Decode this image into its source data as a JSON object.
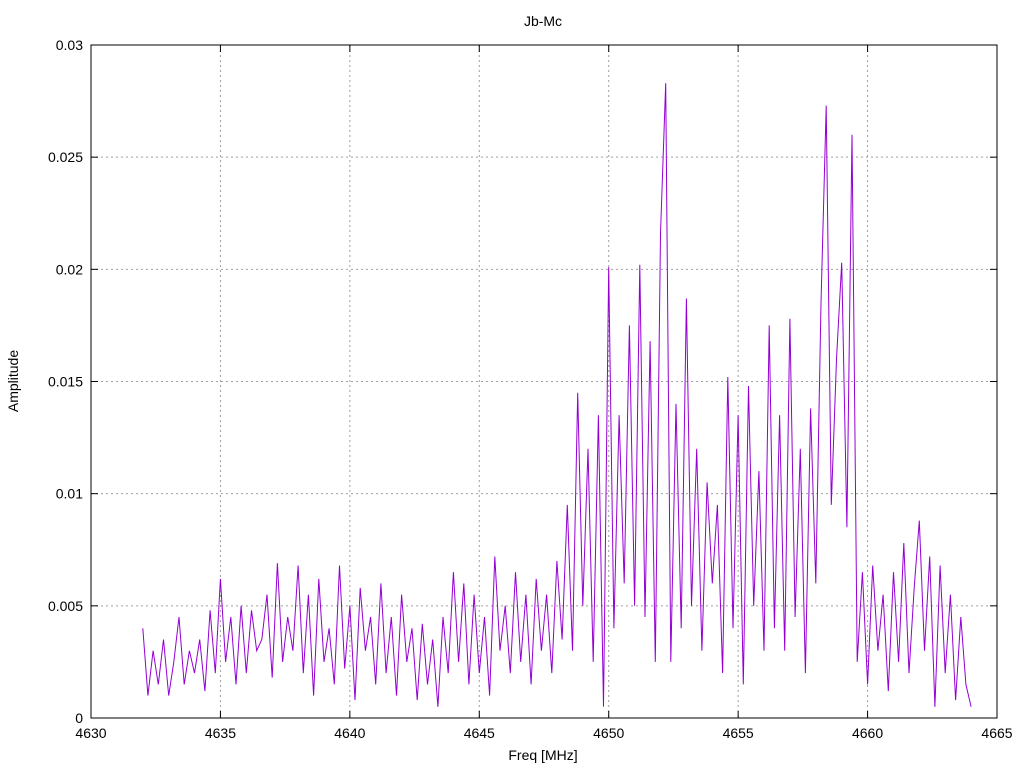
{
  "chart_data": {
    "type": "line",
    "title": "Jb-Mc",
    "xlabel": "Freq [MHz]",
    "ylabel": "Amplitude",
    "xlim": [
      4630,
      4665
    ],
    "ylim": [
      0,
      0.03
    ],
    "grid": true,
    "xticks": [
      "4630",
      "4635",
      "4640",
      "4645",
      "4650",
      "4655",
      "4660",
      "4665"
    ],
    "yticks": [
      "0",
      "0.005",
      "0.01",
      "0.015",
      "0.02",
      "0.025",
      "0.03"
    ],
    "series": [
      {
        "name": "Jb-Mc",
        "color": "#9400d3",
        "x_start": 4632,
        "x_step": 0.2,
        "values": [
          0.004,
          0.001,
          0.003,
          0.0015,
          0.0035,
          0.001,
          0.0025,
          0.0045,
          0.0015,
          0.003,
          0.002,
          0.0035,
          0.0012,
          0.0048,
          0.002,
          0.0062,
          0.0025,
          0.0045,
          0.0015,
          0.005,
          0.002,
          0.0048,
          0.003,
          0.0035,
          0.0055,
          0.0018,
          0.0069,
          0.0025,
          0.0045,
          0.003,
          0.0068,
          0.002,
          0.0055,
          0.001,
          0.0062,
          0.0025,
          0.004,
          0.0015,
          0.0068,
          0.0022,
          0.005,
          0.0008,
          0.0058,
          0.003,
          0.0045,
          0.0015,
          0.006,
          0.002,
          0.0045,
          0.001,
          0.0055,
          0.0025,
          0.004,
          0.0008,
          0.0042,
          0.0015,
          0.0035,
          0.0005,
          0.0045,
          0.002,
          0.0065,
          0.0025,
          0.006,
          0.0015,
          0.0055,
          0.002,
          0.0045,
          0.001,
          0.0072,
          0.003,
          0.005,
          0.002,
          0.0065,
          0.0025,
          0.0055,
          0.0015,
          0.0062,
          0.003,
          0.0055,
          0.002,
          0.007,
          0.0035,
          0.0095,
          0.003,
          0.0145,
          0.005,
          0.012,
          0.0025,
          0.0135,
          0.0005,
          0.0201,
          0.004,
          0.0135,
          0.006,
          0.0175,
          0.005,
          0.0202,
          0.0045,
          0.0168,
          0.0025,
          0.0216,
          0.0283,
          0.0025,
          0.014,
          0.004,
          0.0187,
          0.005,
          0.012,
          0.003,
          0.0105,
          0.006,
          0.0095,
          0.002,
          0.0152,
          0.004,
          0.0135,
          0.0015,
          0.0148,
          0.005,
          0.011,
          0.003,
          0.0175,
          0.004,
          0.0135,
          0.003,
          0.0178,
          0.0045,
          0.012,
          0.002,
          0.0138,
          0.006,
          0.0185,
          0.0273,
          0.0095,
          0.016,
          0.0203,
          0.0085,
          0.026,
          0.0025,
          0.0065,
          0.0015,
          0.0068,
          0.003,
          0.0055,
          0.0012,
          0.0065,
          0.0025,
          0.0078,
          0.002,
          0.0058,
          0.0088,
          0.003,
          0.0072,
          0.0005,
          0.0068,
          0.002,
          0.0055,
          0.0008,
          0.0045,
          0.0015,
          0.0005
        ]
      }
    ]
  }
}
